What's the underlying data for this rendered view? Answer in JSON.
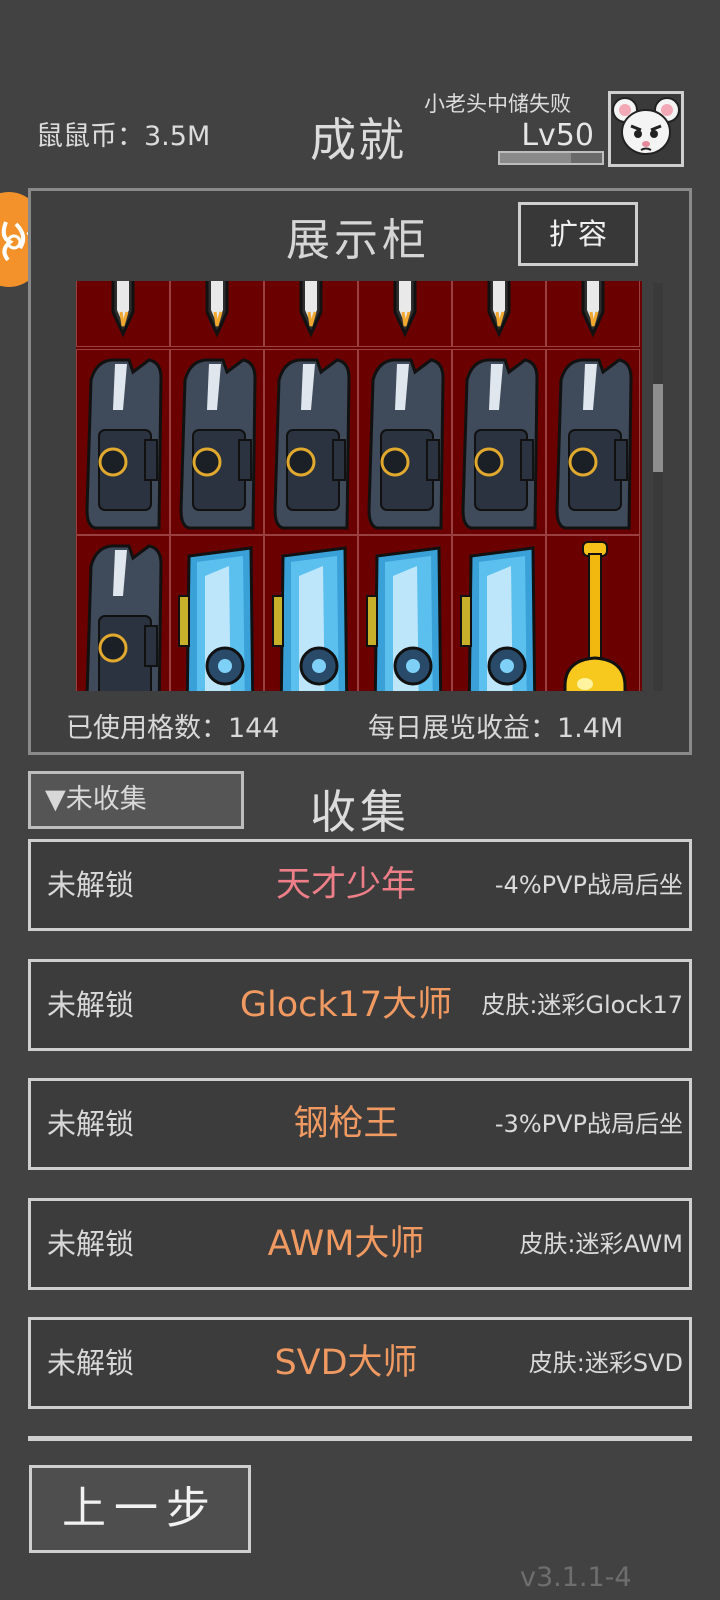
{
  "header": {
    "coin_label": "鼠鼠币：",
    "coin_value": "3.5M",
    "title": "成就",
    "player_name": "小老头中储失败",
    "level": "Lv50"
  },
  "showcase": {
    "title": "展示柜",
    "expand_label": "扩容",
    "grid_items": [
      [
        "knife",
        "knife",
        "knife",
        "knife",
        "knife",
        "knife"
      ],
      [
        "stock",
        "stock",
        "stock",
        "stock",
        "stock",
        "stock"
      ],
      [
        "stock",
        "gpu",
        "gpu",
        "gpu",
        "gpu",
        "golden-shovel"
      ]
    ],
    "used_cells_label": "已使用格数：",
    "used_cells_value": "144",
    "daily_income_label": "每日展览收益：",
    "daily_income_value": "1.4M"
  },
  "collection": {
    "filter_label": "▼未收集",
    "title": "收集",
    "items": [
      {
        "status": "未解锁",
        "name": "天才少年",
        "reward": "-4%PVP战局后坐",
        "color": "#ee7f88"
      },
      {
        "status": "未解锁",
        "name": "Glock17大师",
        "reward": "皮肤:迷彩Glock17",
        "color": "#f09a62"
      },
      {
        "status": "未解锁",
        "name": "钢枪王",
        "reward": "-3%PVP战局后坐",
        "color": "#f09a62"
      },
      {
        "status": "未解锁",
        "name": "AWM大师",
        "reward": "皮肤:迷彩AWM",
        "color": "#f09a62"
      },
      {
        "status": "未解锁",
        "name": "SVD大师",
        "reward": "皮肤:迷彩SVD",
        "color": "#f09a62"
      }
    ]
  },
  "footer": {
    "back_label": "上一步",
    "version": "v3.1.1-4"
  },
  "colors": {
    "background": "#424242",
    "cell_bg": "#6b0000",
    "accent_orange": "#f3922a"
  },
  "icons": [
    "rat-avatar-icon",
    "side-tab-icon",
    "knife-icon",
    "stock-icon",
    "gpu-icon",
    "golden-shovel-icon"
  ],
  "xp_progress": 0.7
}
